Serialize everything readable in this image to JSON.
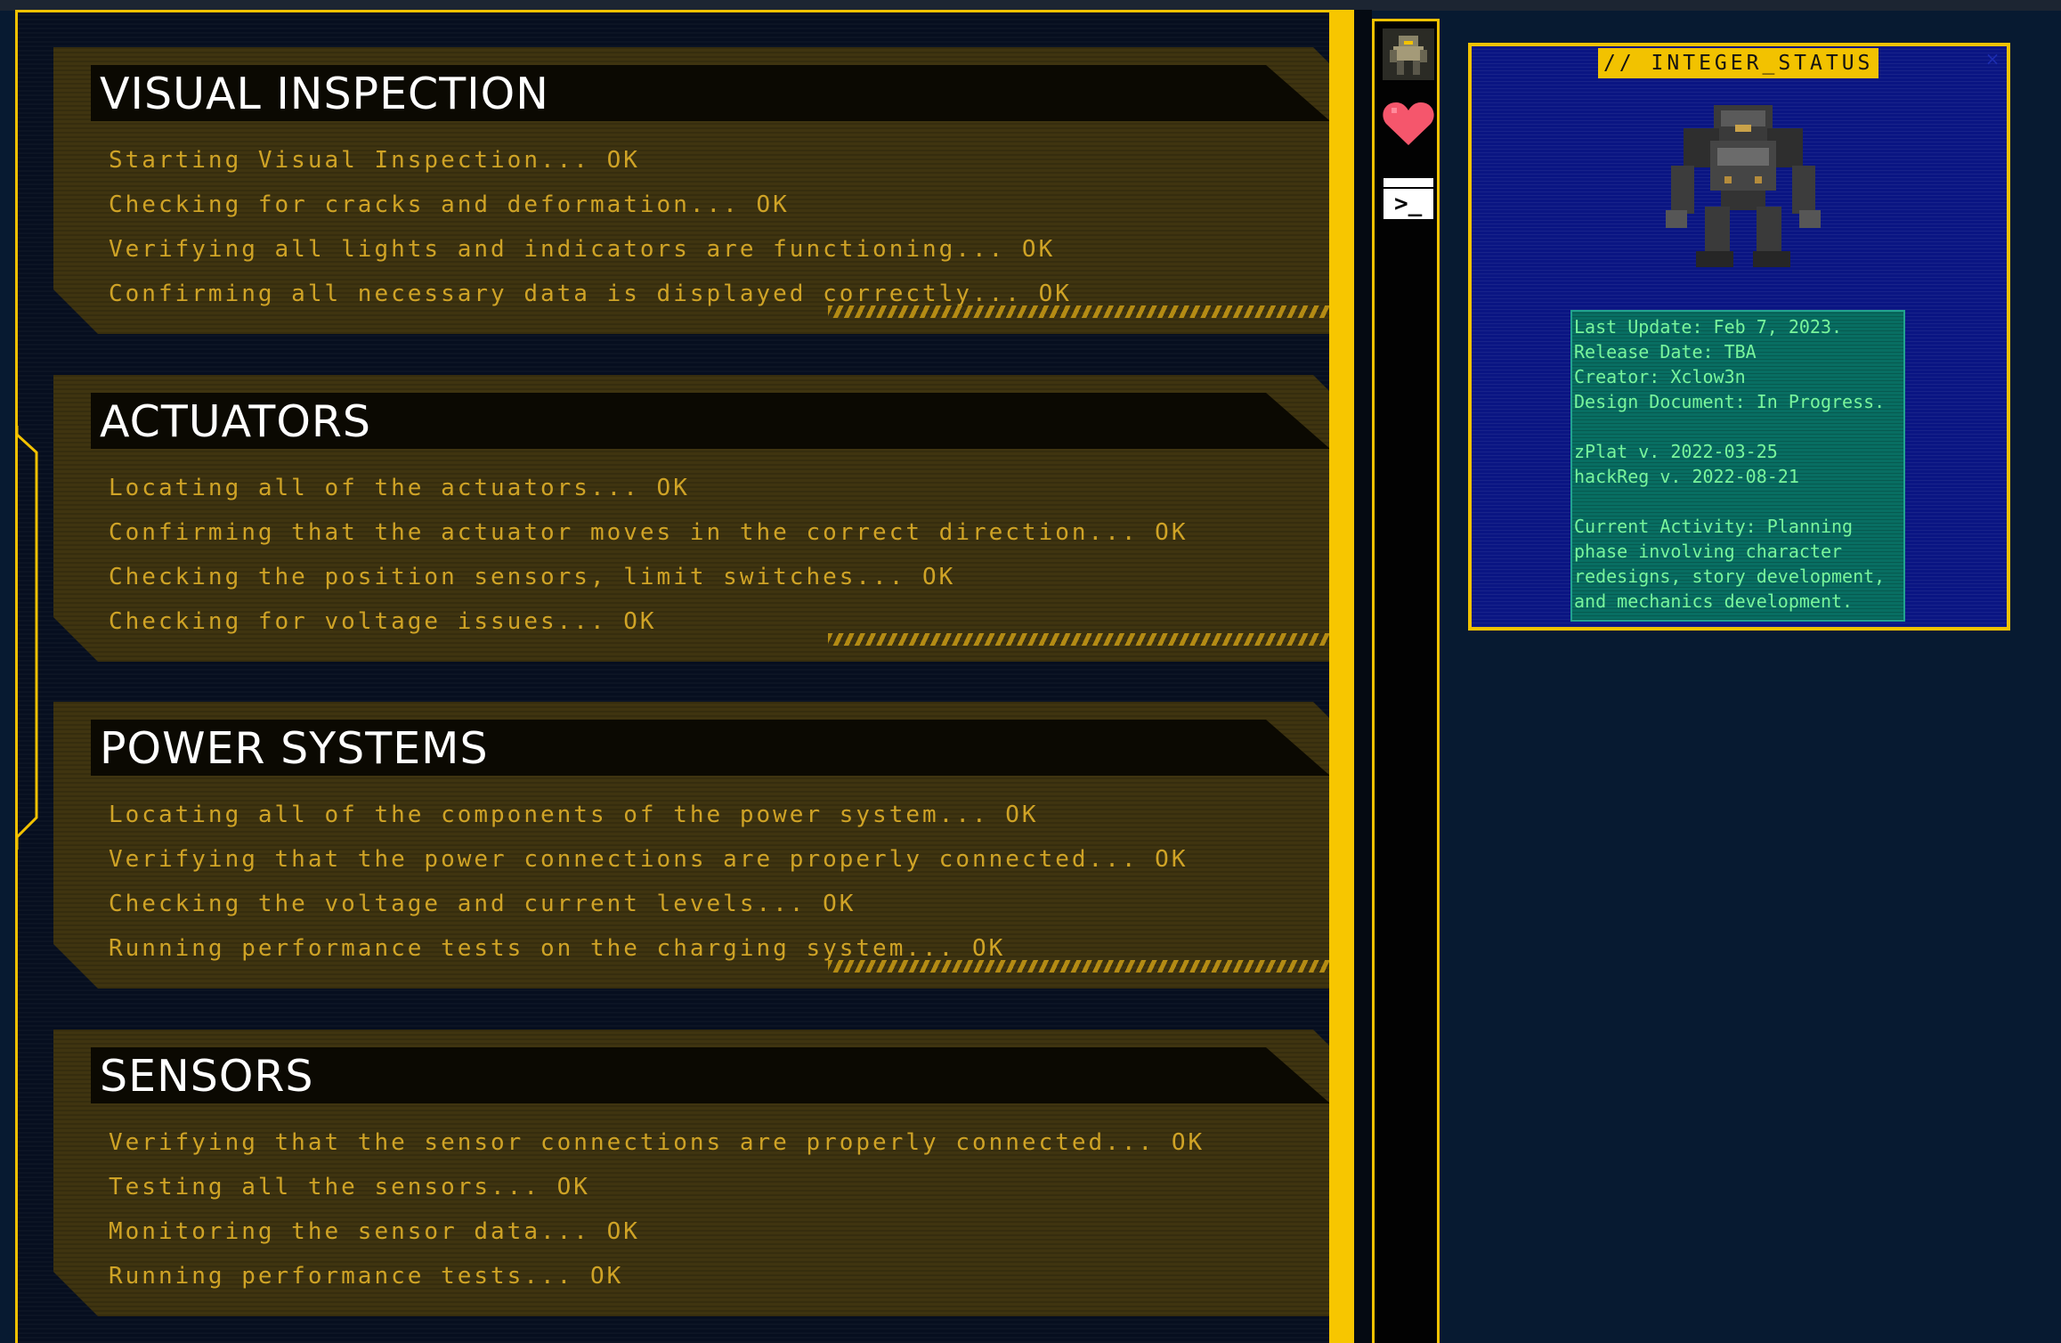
{
  "sections": [
    {
      "title": "VISUAL INSPECTION",
      "steps": [
        "Starting Visual Inspection... OK",
        "Checking for cracks and deformation... OK",
        "Verifying all lights and indicators are functioning... OK",
        "Confirming all necessary data is displayed correctly... OK"
      ]
    },
    {
      "title": "ACTUATORS",
      "steps": [
        "Locating all of the actuators... OK",
        "Confirming that the actuator moves in the correct direction... OK",
        "Checking the position sensors, limit switches... OK",
        "Checking for voltage issues... OK"
      ]
    },
    {
      "title": "POWER SYSTEMS",
      "steps": [
        "Locating all of the components of the power system... OK",
        "Verifying that the power connections are properly connected... OK",
        "Checking the voltage and current levels... OK",
        "Running performance tests on the charging system... OK"
      ]
    },
    {
      "title": "SENSORS",
      "steps": [
        "Verifying that the sensor connections are properly connected... OK",
        "Testing all the sensors... OK",
        "Monitoring the sensor data... OK",
        "Running performance tests... OK"
      ]
    }
  ],
  "toolbar": {
    "items": [
      {
        "icon": "mech-avatar-icon"
      },
      {
        "icon": "heart-icon",
        "color": "#f5566c"
      },
      {
        "icon": "terminal-icon",
        "glyph": ">_"
      }
    ]
  },
  "status_window": {
    "title": "// INTEGER_STATUS",
    "close": "×",
    "info_lines": [
      "Last Update: Feb 7, 2023.",
      "Release Date: TBA",
      "Creator: Xclow3n",
      "Design Document: In Progress.",
      "",
      "zPlat v. 2022-03-25",
      "hackReg v. 2022-08-21",
      "",
      "Current Activity: Planning",
      "phase involving character",
      "redesigns, story development,",
      "and mechanics development."
    ]
  },
  "colors": {
    "accent": "#f2c200",
    "background": "#071a31",
    "section_bg": "#3f3410",
    "step_text": "#cfa326",
    "status_bg": "#0a1583",
    "info_text": "#79f59c"
  }
}
